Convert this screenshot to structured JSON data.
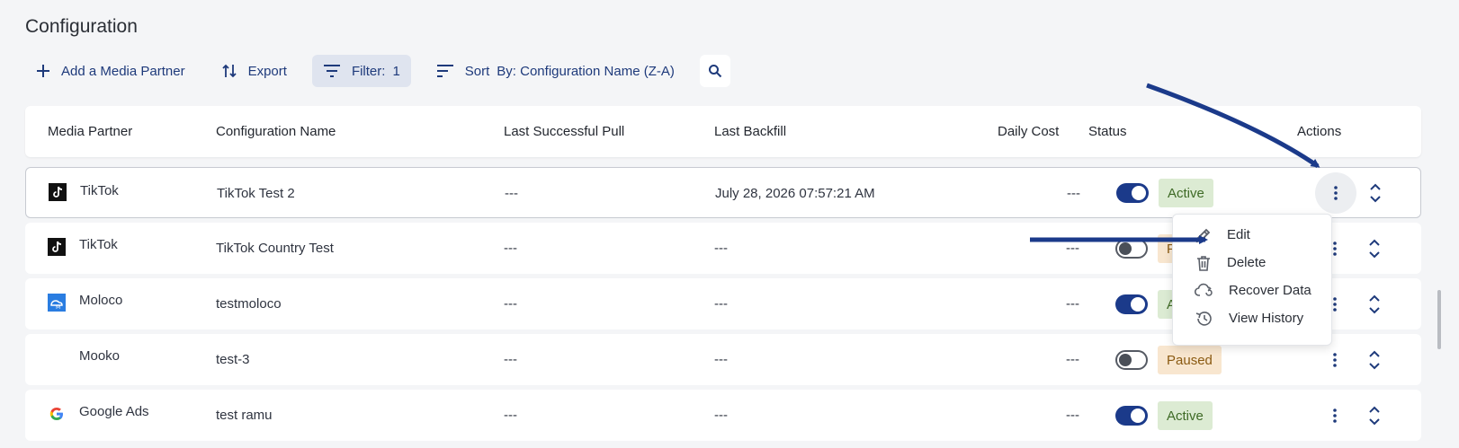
{
  "page": {
    "title": "Configuration"
  },
  "toolbar": {
    "add_label": "Add a Media Partner",
    "export_label": "Export",
    "filter_label": "Filter:",
    "filter_count": "1",
    "sort_label": "Sort",
    "sort_value": "By: Configuration Name (Z-A)"
  },
  "table": {
    "headers": {
      "media_partner": "Media Partner",
      "configuration_name": "Configuration Name",
      "last_successful_pull": "Last Successful Pull",
      "last_backfill": "Last Backfill",
      "daily_cost": "Daily Cost",
      "status": "Status",
      "actions": "Actions"
    },
    "rows": [
      {
        "partner": "TikTok",
        "logo": "tiktok-logo",
        "name": "TikTok Test 2",
        "last_pull": "---",
        "last_backfill": "July 28, 2026 07:57:21 AM",
        "daily_cost": "---",
        "enabled": true,
        "status": "Active"
      },
      {
        "partner": "TikTok",
        "logo": "tiktok-logo",
        "name": "TikTok Country Test",
        "last_pull": "---",
        "last_backfill": "---",
        "daily_cost": "---",
        "enabled": false,
        "status": "Paused"
      },
      {
        "partner": "Moloco",
        "logo": "moloco-logo",
        "name": "testmoloco",
        "last_pull": "---",
        "last_backfill": "---",
        "daily_cost": "---",
        "enabled": true,
        "status": "Active"
      },
      {
        "partner": "Mooko",
        "logo": "",
        "name": "test-3",
        "last_pull": "---",
        "last_backfill": "---",
        "daily_cost": "---",
        "enabled": false,
        "status": "Paused"
      },
      {
        "partner": "Google Ads",
        "logo": "google-logo",
        "name": "test ramu",
        "last_pull": "---",
        "last_backfill": "---",
        "daily_cost": "---",
        "enabled": true,
        "status": "Active"
      }
    ]
  },
  "actions_menu": {
    "edit": "Edit",
    "delete": "Delete",
    "recover": "Recover Data",
    "history": "View History"
  },
  "colors": {
    "accent": "#1b3a8a",
    "active_bg": "#dcebd3",
    "paused_bg": "#f8e6cf",
    "annotation_arrow": "#1b3a8a"
  }
}
